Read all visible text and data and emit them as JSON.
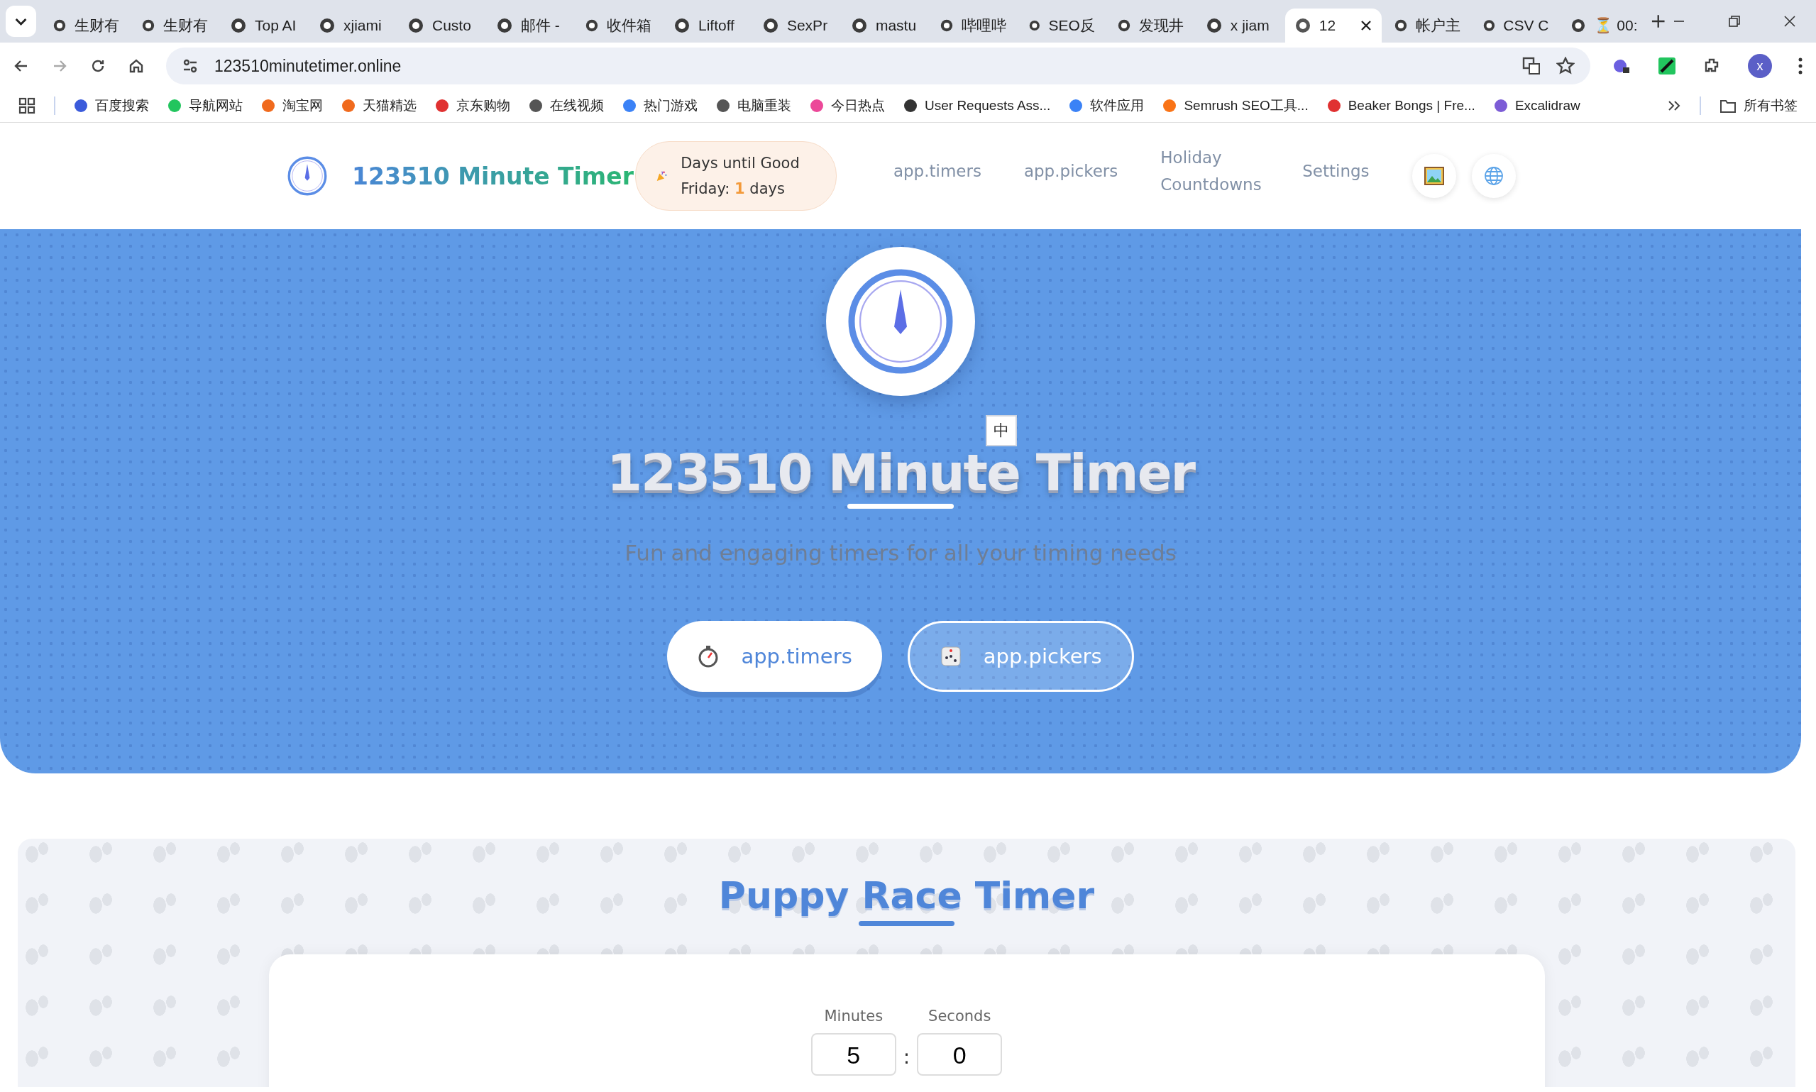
{
  "browser": {
    "tabs": [
      {
        "title": "生财有",
        "selected": false
      },
      {
        "title": "生财有",
        "selected": false
      },
      {
        "title": "Top AI",
        "selected": false
      },
      {
        "title": "xjiami",
        "selected": false
      },
      {
        "title": "Custo",
        "selected": false
      },
      {
        "title": "邮件 -",
        "selected": false
      },
      {
        "title": "收件箱",
        "selected": false
      },
      {
        "title": "Liftoff",
        "selected": false
      },
      {
        "title": "SexPr",
        "selected": false
      },
      {
        "title": "mastu",
        "selected": false
      },
      {
        "title": "哔哩哔",
        "selected": false
      },
      {
        "title": "SEO反",
        "selected": false
      },
      {
        "title": "发现井",
        "selected": false
      },
      {
        "title": "x jiam",
        "selected": false
      },
      {
        "title": "12",
        "selected": true
      },
      {
        "title": "帐户主",
        "selected": false
      },
      {
        "title": "CSV C",
        "selected": false
      },
      {
        "title": "⏳ 00:",
        "selected": false
      }
    ],
    "url": "123510minutetimer.online",
    "bookmarks": [
      "百度搜索",
      "导航网站",
      "淘宝网",
      "天猫精选",
      "京东购物",
      "在线视频",
      "热门游戏",
      "电脑重装",
      "今日热点",
      "User Requests Ass...",
      "软件应用",
      "Semrush SEO工具...",
      "Beaker Bongs | Fre...",
      "Excalidraw"
    ],
    "all_bookmarks": "所有书签",
    "profile_initial": "x"
  },
  "header": {
    "brand": "123510 Minute Timer",
    "countdown": "Days until Good Friday: **1** days",
    "nav": [
      "app.timers",
      "app.pickers",
      "Holiday Countdowns",
      "Settings"
    ]
  },
  "hero": {
    "title": "123510 Minute Timer",
    "translate_popup": "中",
    "subtitle": "Fun and engaging timers for all your timing needs",
    "buttons": [
      {
        "label": "app.timers",
        "kind": "solid"
      },
      {
        "label": "app.pickers",
        "kind": "outline"
      }
    ]
  },
  "timer": {
    "title": "Puppy Race Timer",
    "fields": [
      {
        "label": "Minutes",
        "value": "5"
      },
      {
        "label": "Seconds",
        "value": "0"
      }
    ],
    "separator": ":"
  }
}
